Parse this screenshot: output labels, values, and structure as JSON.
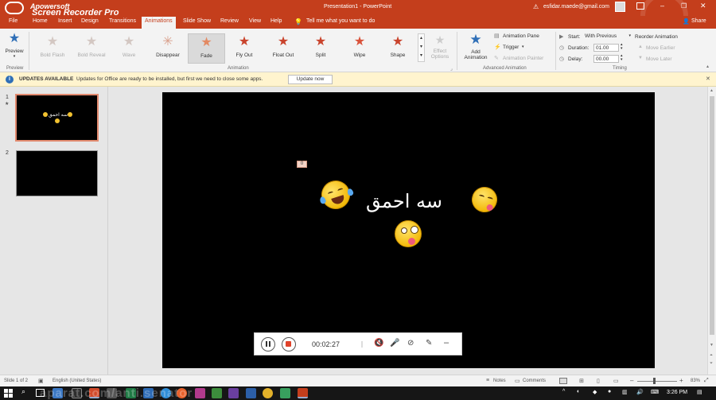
{
  "titlebar": {
    "doc_title": "Presentation1 - PowerPoint",
    "user_email": "esfidar.maede@gmail.com",
    "watermark_line1": "Apowersoft",
    "watermark_line2": "Screen Recorder Pro",
    "share_label": "Share",
    "tell_me": "Tell me what you want to do"
  },
  "tabs": [
    "File",
    "Home",
    "Insert",
    "Design",
    "Transitions",
    "Animations",
    "Slide Show",
    "Review",
    "View",
    "Help"
  ],
  "active_tab": "Animations",
  "ribbon": {
    "preview_label": "Preview",
    "effects": [
      {
        "label": "Bold Flash",
        "color": "#d8c9c3"
      },
      {
        "label": "Bold Reveal",
        "color": "#d8c9c3"
      },
      {
        "label": "Wave",
        "color": "#d8c9c3"
      },
      {
        "label": "Disappear",
        "color": "#c95b3a"
      },
      {
        "label": "Fade",
        "color": "#e38a63"
      },
      {
        "label": "Fly Out",
        "color": "#c9432c"
      },
      {
        "label": "Float Out",
        "color": "#c9432c"
      },
      {
        "label": "Split",
        "color": "#c9432c"
      },
      {
        "label": "Wipe",
        "color": "#d9523a"
      },
      {
        "label": "Shape",
        "color": "#c9432c"
      }
    ],
    "effect_options_label": "Effect Options",
    "add_animation_label": "Add Animation",
    "animation_pane_label": "Animation Pane",
    "trigger_label": "Trigger",
    "animation_painter_label": "Animation Painter",
    "start_label": "Start:",
    "start_value": "With Previous",
    "duration_label": "Duration:",
    "duration_value": "01.00",
    "delay_label": "Delay:",
    "delay_value": "00.00",
    "reorder_label": "Reorder Animation",
    "move_earlier_label": "Move Earlier",
    "move_later_label": "Move Later",
    "groups": {
      "preview": "Preview",
      "animation": "Animation",
      "advanced": "Advanced Animation",
      "timing": "Timing"
    }
  },
  "notification": {
    "title": "UPDATES AVAILABLE",
    "message": "Updates for Office are ready to be installed, but first we need to close some apps.",
    "button": "Update now"
  },
  "thumbnails": [
    {
      "number": "1",
      "marker": "★",
      "text": "سه احمق"
    },
    {
      "number": "2",
      "marker": "",
      "text": ""
    }
  ],
  "slide": {
    "text": "سه احمق",
    "anim_tag": "0"
  },
  "recorder": {
    "time": "00:02:27"
  },
  "status": {
    "slide_info": "Slide 1 of 2",
    "language": "English (United States)",
    "notes_label": "Notes",
    "comments_label": "Comments",
    "zoom": "83%"
  },
  "taskbar": {
    "time": "3:26 PM",
    "watermark": "aparat.com/anti.senator"
  }
}
